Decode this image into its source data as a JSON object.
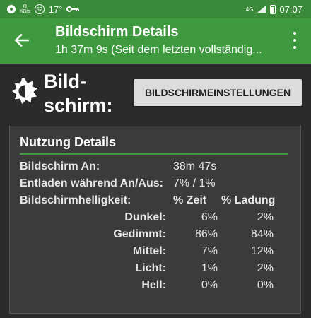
{
  "status_bar": {
    "net_speed": "0",
    "net_unit": "KB/s",
    "notif_badge": "52",
    "temperature": "17°",
    "network_type": "4G",
    "time": "07:07"
  },
  "app_bar": {
    "title": "Bildschirm Details",
    "subtitle": "1h 37m 9s (Seit dem letzten vollständig..."
  },
  "header": {
    "label_line1": "Bild-",
    "label_line2": "schirm:",
    "settings_button": "BILDSCHIRMEINSTELLUNGEN"
  },
  "card": {
    "title": "Nutzung Details",
    "screen_on_label": "Bildschirm An:",
    "screen_on_value": "38m 47s",
    "discharge_label": "Entladen während An/Aus:",
    "discharge_value": "7% / 1%",
    "brightness_label": "Bildschirmhelligkeit:",
    "col_time": "% Zeit",
    "col_charge": "% Ladung",
    "rows": [
      {
        "label": "Dunkel:",
        "time": "6%",
        "charge": "2%"
      },
      {
        "label": "Gedimmt:",
        "time": "86%",
        "charge": "84%"
      },
      {
        "label": "Mittel:",
        "time": "7%",
        "charge": "12%"
      },
      {
        "label": "Licht:",
        "time": "1%",
        "charge": "2%"
      },
      {
        "label": "Hell:",
        "time": "0%",
        "charge": "0%"
      }
    ]
  }
}
